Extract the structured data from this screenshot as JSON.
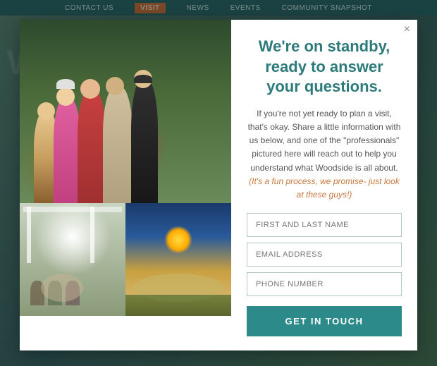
{
  "nav": {
    "items": [
      {
        "label": "CONTACT US",
        "active": false
      },
      {
        "label": "VISIT",
        "active": true
      },
      {
        "label": "NEWS",
        "active": false
      },
      {
        "label": "EVENTS",
        "active": false
      },
      {
        "label": "COMMUNITY SNAPSHOT",
        "active": false
      }
    ]
  },
  "modal": {
    "close_label": "×",
    "headline": "We're on standby, ready to answer your questions.",
    "description_1": "If you're not yet ready to plan a visit, that's okay. Share a little information with us below, and one of the \"professionals\" pictured here will reach out to help you understand what Woodside is all about.",
    "description_fun": "(It's a fun process, we promise- just look at these guys!)",
    "form": {
      "name_placeholder": "FIRST AND LAST NAME",
      "email_placeholder": "EMAIL ADDRESS",
      "phone_placeholder": "PHONE NUMBER"
    },
    "cta_label": "GET IN TOUCH"
  },
  "bg_text": "W"
}
